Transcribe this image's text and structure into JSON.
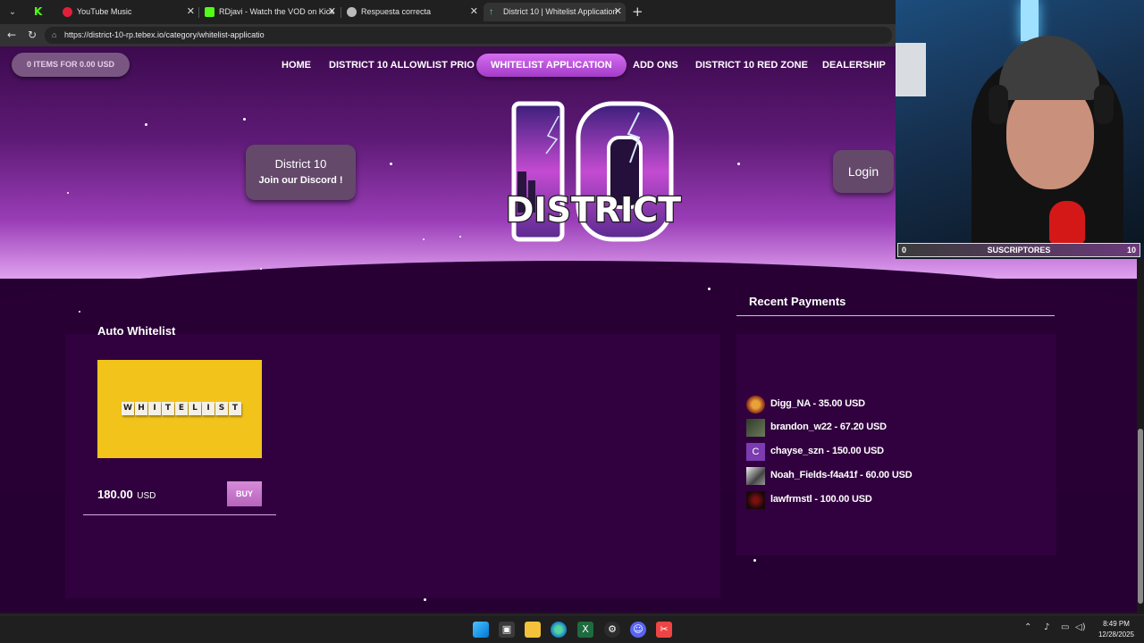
{
  "browser": {
    "tabs": [
      {
        "title": "YouTube Music"
      },
      {
        "title": "RDjavi - Watch the VOD on Kick"
      },
      {
        "title": "Respuesta correcta"
      },
      {
        "title": "District 10 | Whitelist Application"
      }
    ],
    "url": "https://district-10-rp.tebex.io/category/whitelist-applicatio"
  },
  "site": {
    "cart": "0 ITEMS FOR 0.00 USD",
    "nav": [
      "HOME",
      "DISTRICT 10 ALLOWLIST PRIO",
      "WHITELIST APPLICATION",
      "ADD ONS",
      "DISTRICT 10 RED ZONE",
      "DEALERSHIP"
    ],
    "discord": {
      "line1": "District 10",
      "line2": "Join our Discord !"
    },
    "login": "Login",
    "logo": {
      "number": "10",
      "word": "DISTRICT"
    },
    "package": {
      "title": "Auto Whitelist",
      "image_text": "WHITELIST",
      "price": "180.00",
      "currency": "USD",
      "buy": "BUY"
    },
    "recent_payments": {
      "title": "Recent Payments",
      "items": [
        {
          "text": "Digg_NA - 35.00 USD",
          "avatar_letter": ""
        },
        {
          "text": "brandon_w22 - 67.20 USD",
          "avatar_letter": ""
        },
        {
          "text": "chayse_szn - 150.00 USD",
          "avatar_letter": "C"
        },
        {
          "text": "Noah_Fields-f4a41f - 60.00 USD",
          "avatar_letter": ""
        },
        {
          "text": "lawfrmstl - 100.00 USD",
          "avatar_letter": ""
        }
      ]
    }
  },
  "overlay": {
    "subs_left": "0",
    "subs_label": "SUSCRIPTORES",
    "subs_right": "10"
  },
  "taskbar": {
    "time": "8:49 PM",
    "date": "12/28/2025"
  },
  "colors": {
    "accent": "#c25ae0",
    "panel": "#30013e",
    "background": "#270033"
  }
}
